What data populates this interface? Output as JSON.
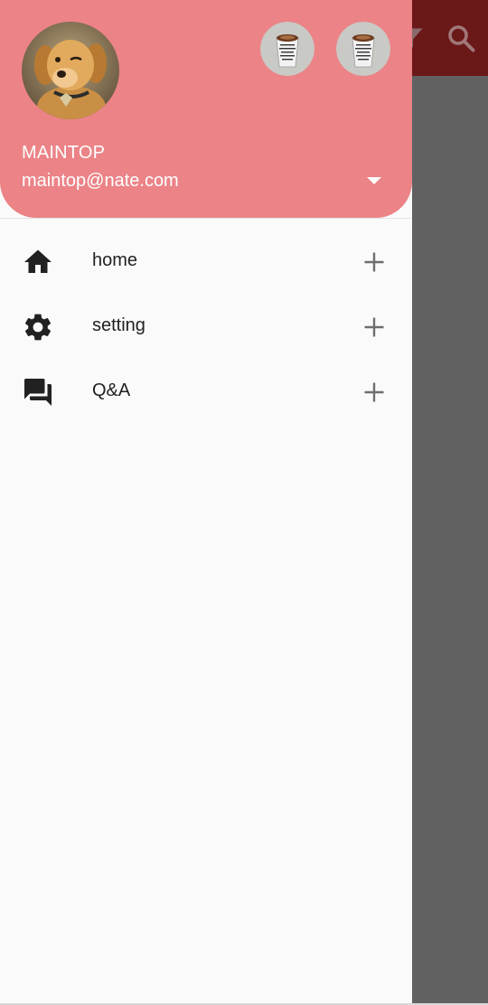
{
  "account": {
    "name": "MAINTOP",
    "email": "maintop@nate.com"
  },
  "menu": [
    {
      "label": "home",
      "icon": "home-icon"
    },
    {
      "label": "setting",
      "icon": "gear-icon"
    },
    {
      "label": "Q&A",
      "icon": "forum-icon"
    }
  ],
  "colors": {
    "header": "#eb8387",
    "drawer": "#fafafa",
    "scrim": "#616161",
    "appbar": "#6b1818"
  }
}
